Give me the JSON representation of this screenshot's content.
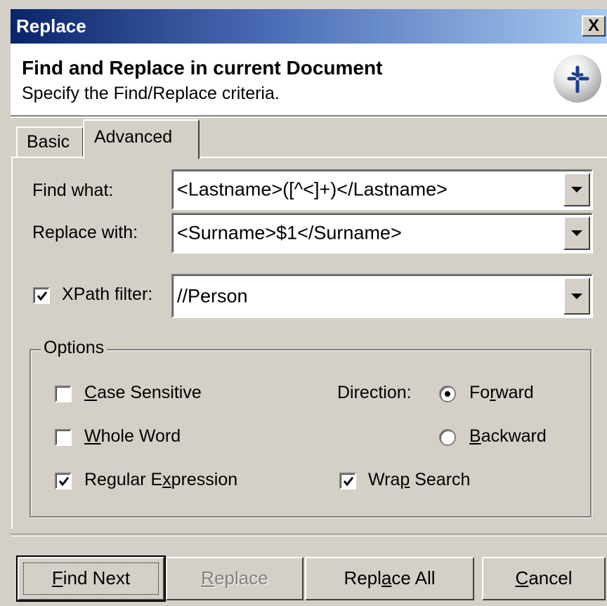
{
  "window": {
    "title": "Replace",
    "close_label": "X"
  },
  "header": {
    "title": "Find and Replace in current Document",
    "subtitle": "Specify the Find/Replace criteria."
  },
  "tabs": [
    {
      "label": "Basic",
      "selected": false
    },
    {
      "label": "Advanced",
      "selected": true
    }
  ],
  "fields": {
    "find_label": "Find what:",
    "find_value": "<Lastname>([^<]+)</Lastname>",
    "replace_label": "Replace with:",
    "replace_value": "<Surname>$1</Surname>",
    "xpath_label": "XPath filter:",
    "xpath_checked": true,
    "xpath_value": "//Person"
  },
  "options": {
    "legend": "Options",
    "case_sensitive": {
      "label_pre": "",
      "label_u": "C",
      "label_post": "ase Sensitive",
      "checked": false
    },
    "whole_word": {
      "label_pre": "",
      "label_u": "W",
      "label_post": "hole Word",
      "checked": false
    },
    "regex": {
      "label_pre": "Regular E",
      "label_u": "x",
      "label_post": "pression",
      "checked": true
    },
    "direction_label": "Direction:",
    "forward": {
      "label_pre": "Fo",
      "label_u": "r",
      "label_post": "ward",
      "selected": true
    },
    "backward": {
      "label_pre": "",
      "label_u": "B",
      "label_post": "ackward",
      "selected": false
    },
    "wrap": {
      "label_pre": "Wra",
      "label_u": "p",
      "label_post": " Search",
      "checked": true
    }
  },
  "buttons": {
    "find_next": {
      "label_pre": "",
      "label_u": "F",
      "label_post": "ind Next"
    },
    "replace": {
      "label_pre": "",
      "label_u": "R",
      "label_post": "eplace",
      "disabled": true
    },
    "replace_all": {
      "label_pre": "Repl",
      "label_u": "a",
      "label_post": "ce All"
    },
    "cancel": {
      "label_pre": "",
      "label_u": "C",
      "label_post": "ancel"
    }
  },
  "colors": {
    "title_gradient_start": "#0a246a",
    "title_gradient_end": "#a6caf0",
    "face": "#d4d0c8"
  },
  "icons": {
    "logo": "crosshair-globe-icon",
    "close": "close-icon",
    "dropdown": "chevron-down-icon",
    "check": "checkmark-icon"
  }
}
